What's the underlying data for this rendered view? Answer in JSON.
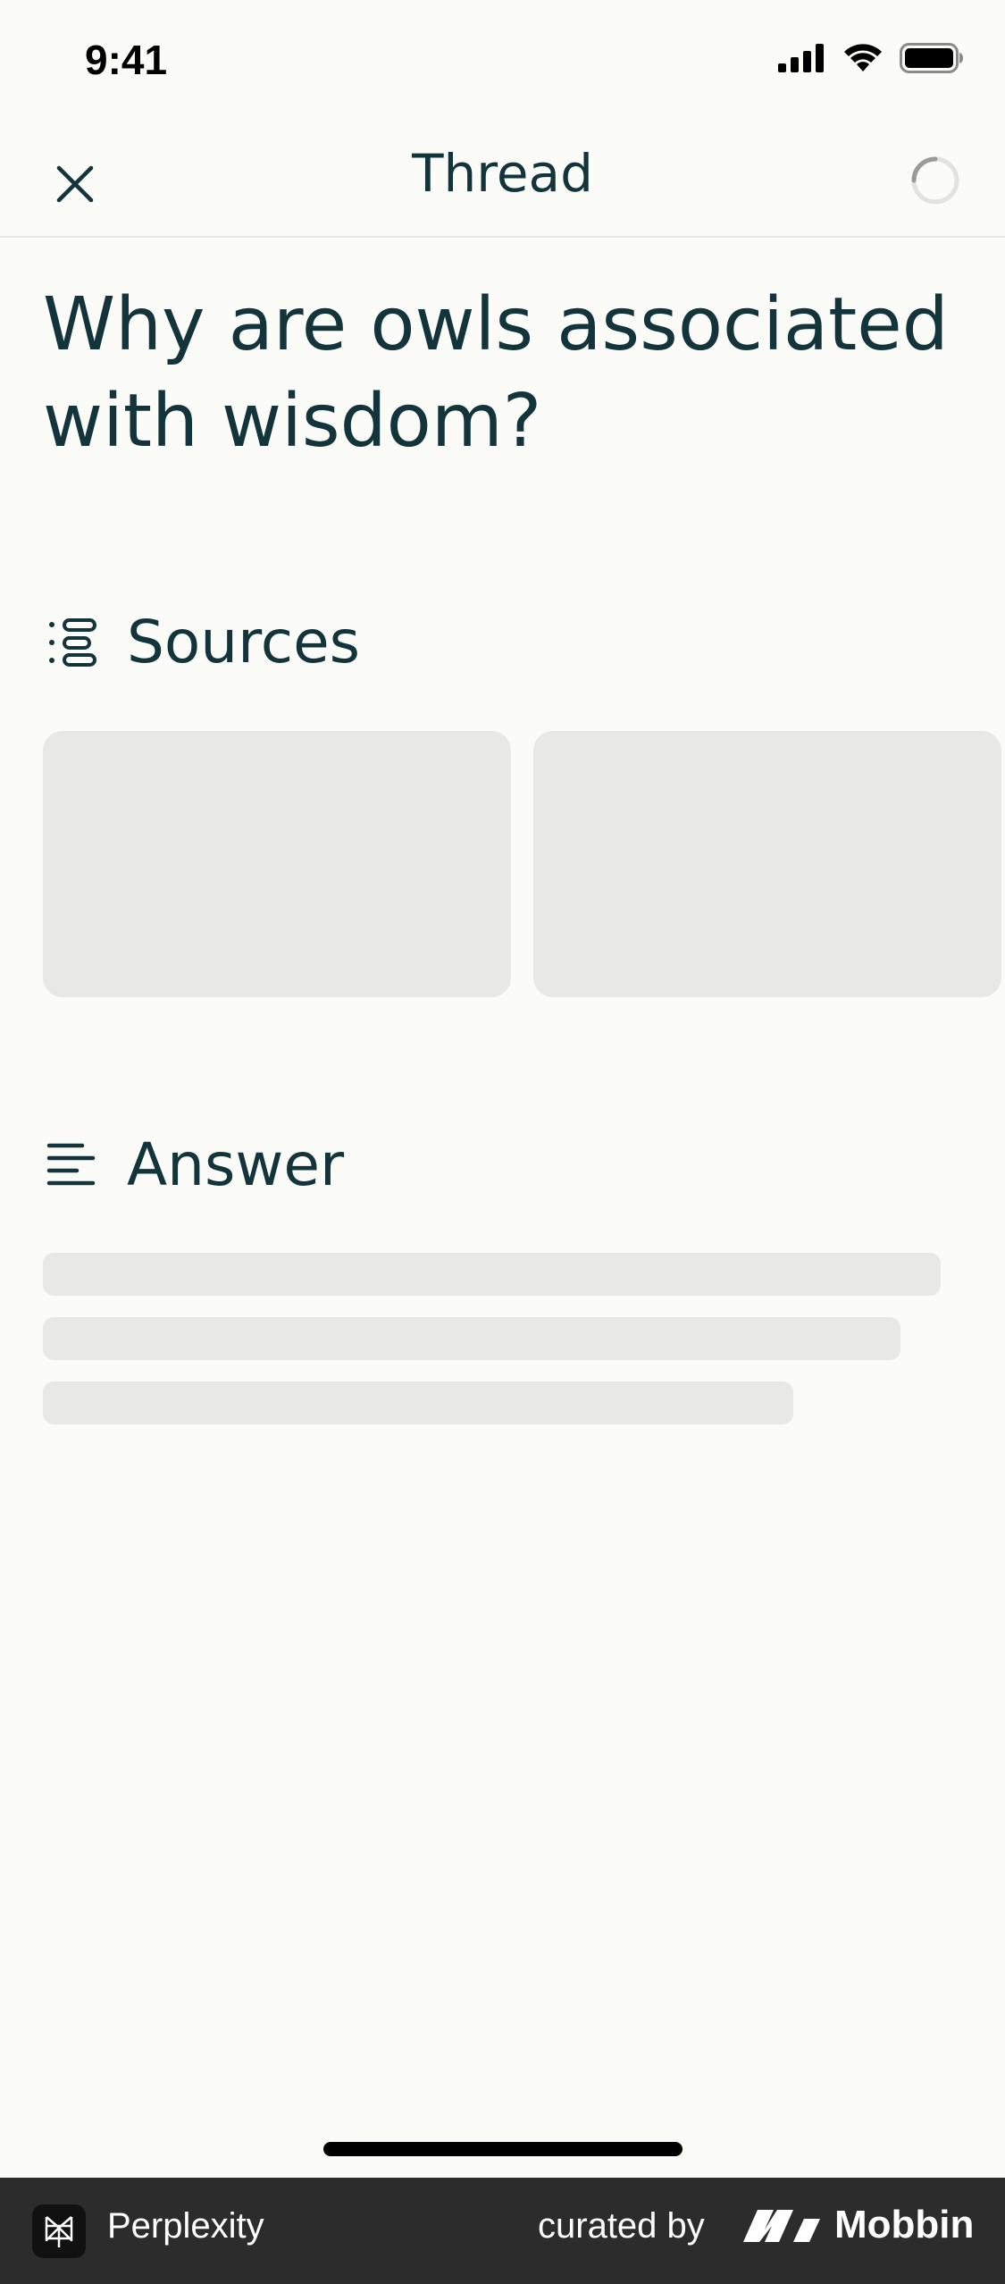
{
  "status_bar": {
    "time": "9:41"
  },
  "nav": {
    "title": "Thread",
    "close_icon": "close-icon",
    "loading_icon": "spinner-icon"
  },
  "thread": {
    "question": "Why are owls associated with wisdom?"
  },
  "sources": {
    "label": "Sources",
    "icon": "sources-list-icon"
  },
  "answer": {
    "label": "Answer",
    "icon": "text-lines-icon"
  },
  "footer": {
    "app_name": "Perplexity",
    "curated_by": "curated by",
    "brand": "Mobbin"
  },
  "colors": {
    "background": "#fbfbf8",
    "text": "#13343b",
    "skeleton": "#e8e8e4",
    "footer_bg": "#2c2c2c"
  }
}
